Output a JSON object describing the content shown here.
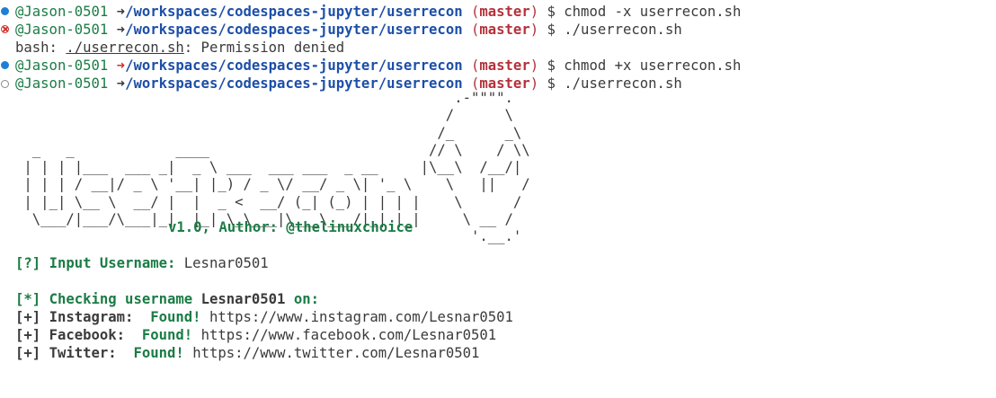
{
  "prompt": {
    "user": "@Jason-0501",
    "arrow": "➜",
    "path": "/workspaces/codespaces-jupyter/userrecon",
    "branch": "master",
    "dollar": "$"
  },
  "lines": [
    {
      "status": "success",
      "command": "chmod -x userrecon.sh"
    },
    {
      "status": "error",
      "command": "./userrecon.sh"
    },
    {
      "status": "success",
      "command": "chmod +x userrecon.sh"
    },
    {
      "status": "running",
      "command": "./userrecon.sh"
    }
  ],
  "error_output": {
    "prefix": "bash: ",
    "file": "./userrecon.sh",
    "message": ": Permission denied"
  },
  "banner": {
    "version_author": "v1.0, Author: @thelinuxchoice"
  },
  "input_prompt": {
    "tag": "[?]",
    "label": "Input Username:",
    "value": "Lesnar0501"
  },
  "checking": {
    "tag": "[*]",
    "prefix": "Checking username",
    "username": "Lesnar0501",
    "suffix": "on:"
  },
  "results": [
    {
      "tag": "[+]",
      "site": "Instagram:",
      "status": "Found!",
      "url": "https://www.instagram.com/Lesnar0501"
    },
    {
      "tag": "[+]",
      "site": "Facebook:",
      "status": "Found!",
      "url": "https://www.facebook.com/Lesnar0501"
    },
    {
      "tag": "[+]",
      "site": "Twitter:",
      "status": "Found!",
      "url": "https://www.twitter.com/Lesnar0501"
    }
  ],
  "colors": {
    "user": "#1b7c45",
    "path": "#1d4fa8",
    "branch": "#b5313a",
    "error": "#d1312c",
    "status_dot": "#1f7fd6"
  }
}
